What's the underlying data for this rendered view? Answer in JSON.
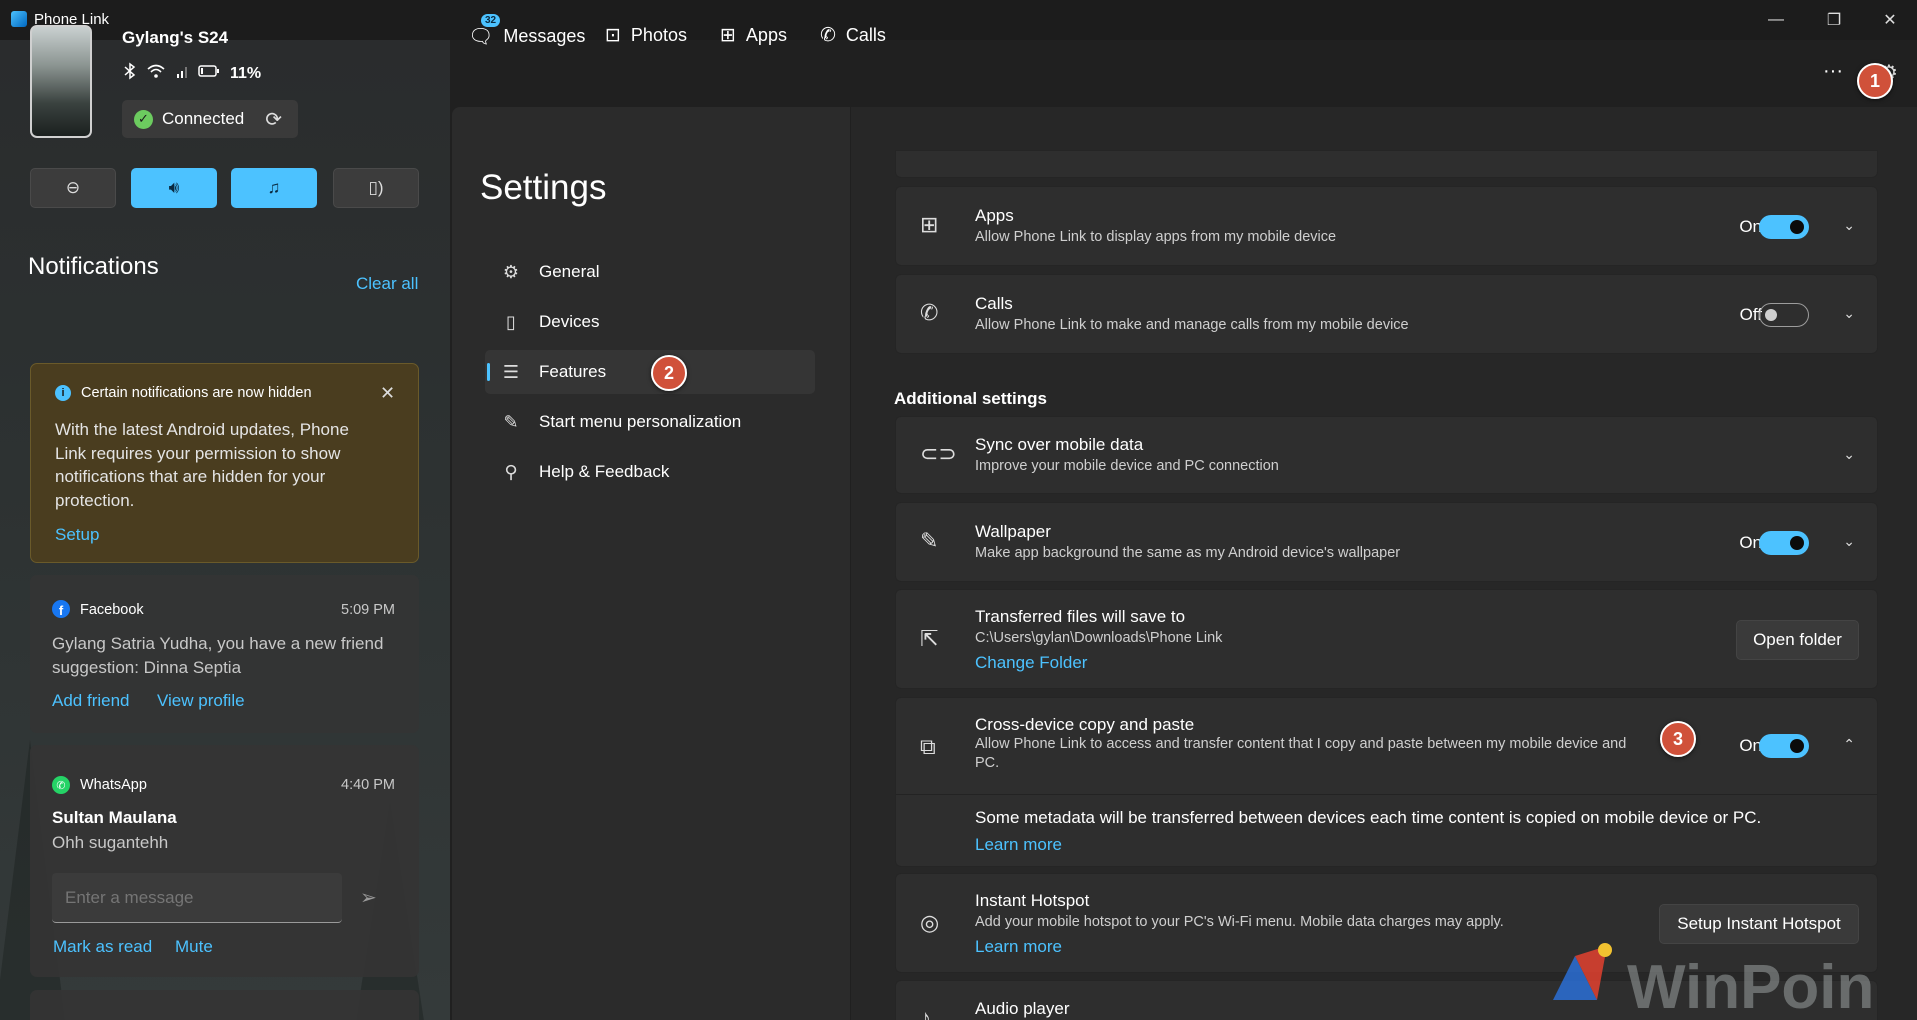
{
  "window": {
    "title": "Phone Link",
    "minimize": "—",
    "maximize": "❐",
    "close": "✕"
  },
  "device": {
    "name": "Gylang's S24",
    "battery": "11%",
    "connection": "Connected"
  },
  "notifications": {
    "title": "Notifications",
    "clear_all": "Clear all",
    "warning": {
      "title": "Certain notifications are now hidden",
      "body": "With the latest Android updates, Phone Link requires your permission to show notifications that are hidden for your protection.",
      "action": "Setup"
    },
    "facebook": {
      "app": "Facebook",
      "time": "5:09 PM",
      "body": "Gylang Satria Yudha, you have a new friend suggestion: Dinna Septia",
      "action1": "Add friend",
      "action2": "View profile"
    },
    "whatsapp": {
      "app": "WhatsApp",
      "time": "4:40 PM",
      "sender": "Sultan Maulana",
      "message": "Ohh sugantehh",
      "input_placeholder": "Enter a message",
      "action1": "Mark as read",
      "action2": "Mute"
    }
  },
  "topnav": {
    "badge": "32",
    "messages": "Messages",
    "photos": "Photos",
    "apps": "Apps",
    "calls": "Calls",
    "more": "···"
  },
  "settings": {
    "title": "Settings",
    "nav": {
      "general": "General",
      "devices": "Devices",
      "features": "Features",
      "start_menu": "Start menu personalization",
      "help": "Help & Feedback"
    }
  },
  "features": {
    "apps": {
      "title": "Apps",
      "desc": "Allow Phone Link to display apps from my mobile device",
      "state": "On"
    },
    "calls": {
      "title": "Calls",
      "desc": "Allow Phone Link to make and manage calls from my mobile device",
      "state": "Off"
    },
    "additional_header": "Additional settings",
    "sync": {
      "title": "Sync over mobile data",
      "desc": "Improve your mobile device and PC connection"
    },
    "wallpaper": {
      "title": "Wallpaper",
      "desc": "Make app background the same as my Android device's wallpaper",
      "state": "On"
    },
    "transfer": {
      "title": "Transferred files will save to",
      "path": "C:\\Users\\gylan\\Downloads\\Phone Link",
      "link": "Change Folder",
      "button": "Open folder"
    },
    "crossdevice": {
      "title": "Cross-device copy and paste",
      "desc": "Allow Phone Link to access and transfer content that I copy and paste between my mobile device and",
      "desc2": "PC.",
      "state": "On",
      "detail": "Some metadata will be transferred between devices each time content is copied on mobile device or PC.",
      "detail_link": "Learn more"
    },
    "hotspot": {
      "title": "Instant Hotspot",
      "desc": "Add your mobile hotspot to your PC's Wi-Fi menu. Mobile data charges may apply.",
      "link": "Learn more",
      "button": "Setup Instant Hotspot"
    },
    "audio": {
      "title": "Audio player"
    }
  },
  "markers": {
    "m1": "1",
    "m2": "2",
    "m3": "3"
  },
  "watermark": "WinPoin"
}
